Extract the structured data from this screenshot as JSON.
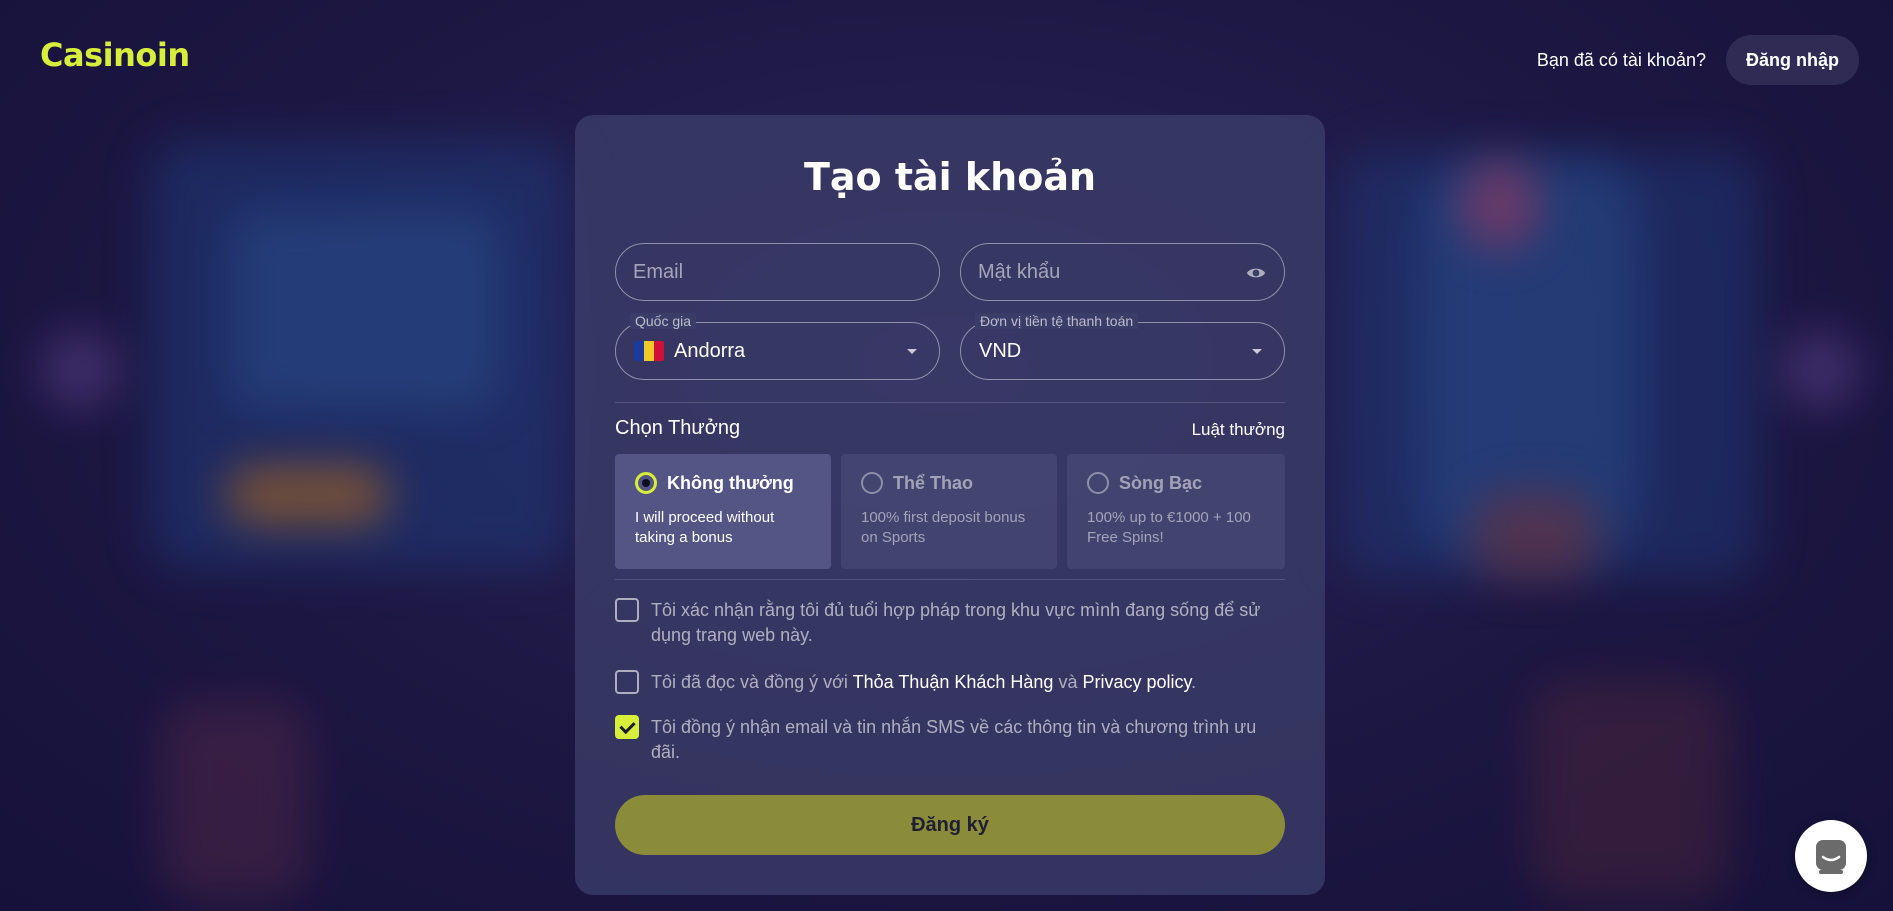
{
  "header": {
    "logo_text": "Casinoin",
    "have_account_text": "Bạn đã có tài khoản?",
    "login_label": "Đăng nhập"
  },
  "form": {
    "title": "Tạo tài khoản",
    "email": {
      "placeholder": "Email",
      "value": ""
    },
    "password": {
      "placeholder": "Mật khẩu",
      "value": ""
    },
    "country": {
      "label": "Quốc gia",
      "value": "Andorra"
    },
    "currency": {
      "label": "Đơn vị tiền tệ thanh toán",
      "value": "VND"
    },
    "bonus": {
      "heading": "Chọn Thưởng",
      "rules_link": "Luật thưởng",
      "options": [
        {
          "title": "Không thưởng",
          "description": "I will proceed without taking a bonus",
          "selected": true
        },
        {
          "title": "Thể Thao",
          "description": "100% first deposit bonus on Sports",
          "selected": false
        },
        {
          "title": "Sòng Bạc",
          "description": "100% up to €1000 + 100 Free Spins!",
          "selected": false
        }
      ]
    },
    "checks": {
      "age_text": "Tôi xác nhận rằng tôi đủ tuổi hợp pháp trong khu vực mình đang sống để sử dụng trang web này.",
      "terms_prefix": "Tôi đã đọc và đồng ý với",
      "terms_link": "Thỏa Thuận Khách Hàng",
      "terms_and": "và",
      "privacy_link": "Privacy policy",
      "terms_suffix": ".",
      "marketing_text": "Tôi đồng ý nhận email và tin nhắn SMS về các thông tin và chương trình ưu đãi."
    },
    "submit_label": "Đăng ký"
  },
  "colors": {
    "accent": "#d7ef3a",
    "submit_bg": "#8b8c3a",
    "card_bg": "#3c3e69",
    "page_bg": "#1c1640"
  },
  "icons": {
    "password_toggle": "eye-icon",
    "select_caret": "chevron-down-icon",
    "chat": "chat-icon"
  }
}
